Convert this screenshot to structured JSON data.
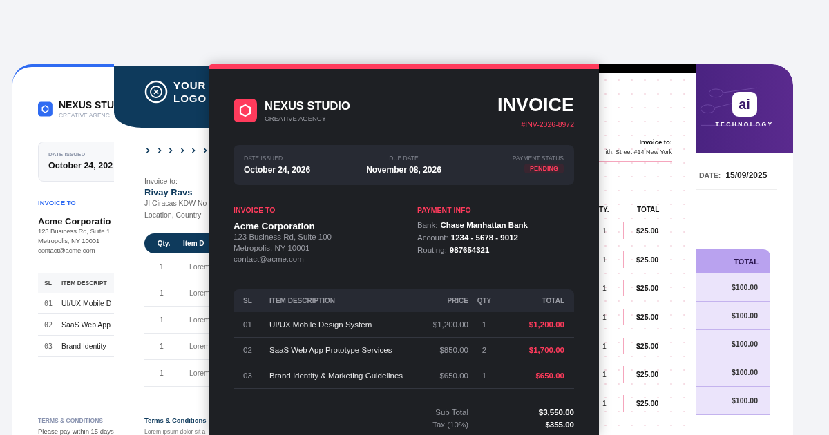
{
  "templates": [
    {
      "kind": "light",
      "brand": {
        "name": "NEXUS STU",
        "tagline": "CREATIVE AGENC"
      },
      "date_label": "DATE ISSUED",
      "date": "October 24, 202",
      "bill_to_label": "INVOICE TO",
      "client": "Acme Corporatio",
      "address": [
        "123 Business Rd, Suite 1",
        "Metropolis, NY 10001",
        "contact@acme.com"
      ],
      "columns": [
        "SL",
        "ITEM DESCRIPT"
      ],
      "rows": [
        [
          "01",
          "UI/UX Mobile D"
        ],
        [
          "02",
          "SaaS Web App"
        ],
        [
          "03",
          "Brand Identity"
        ]
      ],
      "terms_label": "TERMS & CONDITIONS",
      "terms": "Please pay within 15 days"
    },
    {
      "kind": "navy",
      "logo": [
        "YOUR",
        "LOGO"
      ],
      "bill_to_label": "Invoice to:",
      "client": "Rivay Ravs",
      "address": [
        "JI Ciracas KDW No",
        "Location, Country"
      ],
      "columns": [
        "Qty.",
        "Item D"
      ],
      "rows": [
        [
          "1",
          "Lorem"
        ],
        [
          "1",
          "Lorem"
        ],
        [
          "1",
          "Lorem"
        ],
        [
          "1",
          "Lorem"
        ],
        [
          "1",
          "Lorem"
        ]
      ],
      "terms_label": "Terms & Conditions",
      "terms": "Lorem ipsum dolor sit a"
    },
    {
      "kind": "dark",
      "brand": {
        "name": "NEXUS STUDIO",
        "tagline": "CREATIVE AGENCY"
      },
      "title": "INVOICE",
      "number": "#INV-2026-8972",
      "meta": [
        {
          "label": "DATE ISSUED",
          "value": "October 24, 2026",
          "kind": "text"
        },
        {
          "label": "DUE DATE",
          "value": "November 08, 2026",
          "kind": "text"
        },
        {
          "label": "PAYMENT STATUS",
          "value": "PENDING",
          "kind": "badge"
        }
      ],
      "bill_to_label": "INVOICE TO",
      "client": "Acme Corporation",
      "address": [
        "123 Business Rd, Suite 100",
        "Metropolis, NY 10001",
        "contact@acme.com"
      ],
      "payment_label": "PAYMENT INFO",
      "payment": [
        {
          "label": "Bank:",
          "value": "Chase Manhattan Bank"
        },
        {
          "label": "Account:",
          "value": "1234 - 5678 - 9012"
        },
        {
          "label": "Routing:",
          "value": "987654321"
        }
      ],
      "columns": [
        "SL",
        "ITEM DESCRIPTION",
        "PRICE",
        "QTY",
        "TOTAL"
      ],
      "rows": [
        [
          "01",
          "UI/UX Mobile Design System",
          "$1,200.00",
          "1",
          "$1,200.00"
        ],
        [
          "02",
          "SaaS Web App Prototype Services",
          "$850.00",
          "2",
          "$1,700.00"
        ],
        [
          "03",
          "Brand Identity & Marketing Guidelines",
          "$650.00",
          "1",
          "$650.00"
        ]
      ],
      "totals": [
        {
          "label": "Sub Total",
          "value": "$3,550.00"
        },
        {
          "label": "Tax (10%)",
          "value": "$355.00"
        }
      ]
    },
    {
      "kind": "dotted",
      "bill_to_label": "Invoice to:",
      "client": "ith, Street #14 New York",
      "columns": [
        "TY.",
        "TOTAL"
      ],
      "rows": [
        [
          "1",
          "$25.00"
        ],
        [
          "1",
          "$25.00"
        ],
        [
          "1",
          "$25.00"
        ],
        [
          "1",
          "$25.00"
        ],
        [
          "1",
          "$25.00"
        ],
        [
          "1",
          "$25.00"
        ],
        [
          "1",
          "$25.00"
        ]
      ]
    },
    {
      "kind": "purple",
      "logo": "ai",
      "tagline": "TECHNOLOGY",
      "date_label": "DATE:",
      "date": "15/09/2025",
      "columns": [
        "TOTAL"
      ],
      "rows": [
        [
          "$100.00"
        ],
        [
          "$100.00"
        ],
        [
          "$100.00"
        ],
        [
          "$100.00"
        ],
        [
          "$100.00"
        ]
      ]
    }
  ]
}
